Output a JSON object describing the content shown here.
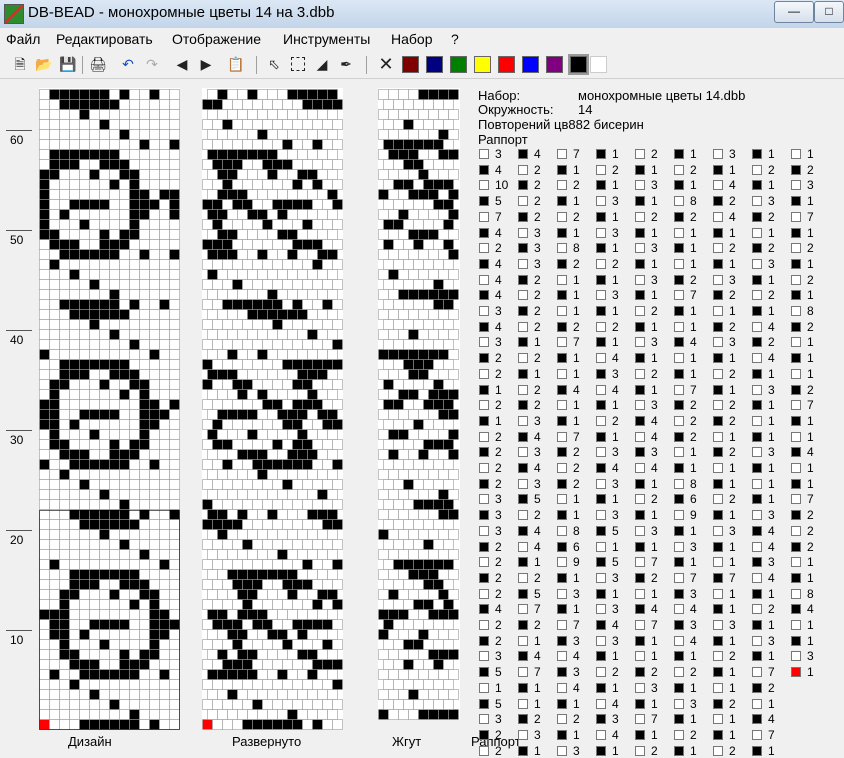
{
  "window": {
    "title": "DB-BEAD - монохромные цветы 14 на 3.dbb"
  },
  "menu": [
    "Файл",
    "Редактировать",
    "Отображение",
    "Инструменты",
    "Набор",
    "?"
  ],
  "palette": [
    "#800000",
    "#000080",
    "#008000",
    "#ffff00",
    "#ff0000",
    "#0000ff",
    "#800080",
    "#000000",
    "#ffffff"
  ],
  "ruler": [
    "60",
    "50",
    "40",
    "30",
    "20",
    "10"
  ],
  "panels": {
    "design": "Дизайн",
    "expanded": "Развернуто",
    "rope": "Жгут",
    "rapport": "Раппорт"
  },
  "info": {
    "set_label": "Набор:",
    "set_value": "монохромные цветы 14.dbb",
    "circ_label": "Окружность:",
    "circ_value": "14",
    "repeat_text": "Повторений цв882 бисерин",
    "rapport_label": "Раппорт"
  },
  "rapport": [
    [
      [
        "w",
        "3"
      ],
      [
        "b",
        "4"
      ],
      [
        "w",
        "7"
      ],
      [
        "b",
        "1"
      ],
      [
        "w",
        "2"
      ],
      [
        "b",
        "1"
      ],
      [
        "w",
        "3"
      ],
      [
        "b",
        "1"
      ],
      [
        "w",
        "1"
      ]
    ],
    [
      [
        "b",
        "4"
      ],
      [
        "w",
        "2"
      ],
      [
        "b",
        "1"
      ],
      [
        "w",
        "2"
      ],
      [
        "b",
        "1"
      ],
      [
        "w",
        "2"
      ],
      [
        "b",
        "1"
      ],
      [
        "w",
        "2"
      ],
      [
        "b",
        "2"
      ]
    ],
    [
      [
        "w",
        "10"
      ],
      [
        "b",
        "2"
      ],
      [
        "w",
        "2"
      ],
      [
        "b",
        "1"
      ],
      [
        "w",
        "3"
      ],
      [
        "b",
        "1"
      ],
      [
        "w",
        "4"
      ],
      [
        "b",
        "1"
      ],
      [
        "w",
        "3"
      ]
    ],
    [
      [
        "b",
        "5"
      ],
      [
        "w",
        "2"
      ],
      [
        "b",
        "1"
      ],
      [
        "w",
        "3"
      ],
      [
        "b",
        "1"
      ],
      [
        "w",
        "8"
      ],
      [
        "b",
        "2"
      ],
      [
        "w",
        "3"
      ],
      [
        "b",
        "1"
      ]
    ],
    [
      [
        "w",
        "7"
      ],
      [
        "b",
        "2"
      ],
      [
        "w",
        "2"
      ],
      [
        "b",
        "1"
      ],
      [
        "w",
        "2"
      ],
      [
        "b",
        "2"
      ],
      [
        "w",
        "4"
      ],
      [
        "b",
        "2"
      ],
      [
        "w",
        "7"
      ]
    ],
    [
      [
        "b",
        "4"
      ],
      [
        "w",
        "3"
      ],
      [
        "b",
        "1"
      ],
      [
        "w",
        "3"
      ],
      [
        "b",
        "1"
      ],
      [
        "w",
        "1"
      ],
      [
        "b",
        "1"
      ],
      [
        "w",
        "1"
      ],
      [
        "b",
        "1"
      ]
    ],
    [
      [
        "w",
        "2"
      ],
      [
        "b",
        "3"
      ],
      [
        "w",
        "8"
      ],
      [
        "b",
        "1"
      ],
      [
        "w",
        "3"
      ],
      [
        "b",
        "1"
      ],
      [
        "w",
        "2"
      ],
      [
        "b",
        "2"
      ],
      [
        "w",
        "2"
      ]
    ],
    [
      [
        "b",
        "4"
      ],
      [
        "w",
        "3"
      ],
      [
        "b",
        "2"
      ],
      [
        "w",
        "2"
      ],
      [
        "b",
        "1"
      ],
      [
        "w",
        "1"
      ],
      [
        "b",
        "1"
      ],
      [
        "w",
        "3"
      ],
      [
        "b",
        "1"
      ]
    ],
    [
      [
        "w",
        "4"
      ],
      [
        "b",
        "2"
      ],
      [
        "w",
        "1"
      ],
      [
        "b",
        "1"
      ],
      [
        "w",
        "3"
      ],
      [
        "b",
        "2"
      ],
      [
        "w",
        "3"
      ],
      [
        "b",
        "1"
      ],
      [
        "w",
        "2"
      ]
    ],
    [
      [
        "b",
        "4"
      ],
      [
        "w",
        "2"
      ],
      [
        "b",
        "1"
      ],
      [
        "w",
        "3"
      ],
      [
        "b",
        "1"
      ],
      [
        "w",
        "7"
      ],
      [
        "b",
        "2"
      ],
      [
        "w",
        "2"
      ],
      [
        "b",
        "1"
      ]
    ],
    [
      [
        "w",
        "3"
      ],
      [
        "b",
        "2"
      ],
      [
        "w",
        "1"
      ],
      [
        "b",
        "1"
      ],
      [
        "w",
        "2"
      ],
      [
        "b",
        "1"
      ],
      [
        "w",
        "1"
      ],
      [
        "b",
        "1"
      ],
      [
        "w",
        "8"
      ]
    ],
    [
      [
        "b",
        "4"
      ],
      [
        "w",
        "2"
      ],
      [
        "b",
        "2"
      ],
      [
        "w",
        "2"
      ],
      [
        "b",
        "1"
      ],
      [
        "w",
        "1"
      ],
      [
        "b",
        "2"
      ],
      [
        "w",
        "4"
      ],
      [
        "b",
        "2"
      ]
    ],
    [
      [
        "w",
        "3"
      ],
      [
        "b",
        "1"
      ],
      [
        "w",
        "7"
      ],
      [
        "b",
        "1"
      ],
      [
        "w",
        "3"
      ],
      [
        "b",
        "4"
      ],
      [
        "w",
        "3"
      ],
      [
        "b",
        "2"
      ],
      [
        "w",
        "1"
      ]
    ],
    [
      [
        "b",
        "2"
      ],
      [
        "w",
        "2"
      ],
      [
        "b",
        "1"
      ],
      [
        "w",
        "4"
      ],
      [
        "b",
        "1"
      ],
      [
        "w",
        "1"
      ],
      [
        "b",
        "1"
      ],
      [
        "w",
        "4"
      ],
      [
        "b",
        "1"
      ]
    ],
    [
      [
        "w",
        "2"
      ],
      [
        "b",
        "1"
      ],
      [
        "w",
        "1"
      ],
      [
        "b",
        "3"
      ],
      [
        "w",
        "2"
      ],
      [
        "b",
        "1"
      ],
      [
        "w",
        "2"
      ],
      [
        "b",
        "1"
      ],
      [
        "w",
        "1"
      ]
    ],
    [
      [
        "b",
        "1"
      ],
      [
        "w",
        "2"
      ],
      [
        "b",
        "4"
      ],
      [
        "w",
        "4"
      ],
      [
        "b",
        "1"
      ],
      [
        "w",
        "7"
      ],
      [
        "b",
        "1"
      ],
      [
        "w",
        "3"
      ],
      [
        "b",
        "2"
      ]
    ],
    [
      [
        "w",
        "2"
      ],
      [
        "b",
        "2"
      ],
      [
        "w",
        "1"
      ],
      [
        "b",
        "1"
      ],
      [
        "w",
        "3"
      ],
      [
        "b",
        "2"
      ],
      [
        "w",
        "2"
      ],
      [
        "b",
        "1"
      ],
      [
        "w",
        "7"
      ]
    ],
    [
      [
        "b",
        "1"
      ],
      [
        "w",
        "3"
      ],
      [
        "b",
        "1"
      ],
      [
        "w",
        "2"
      ],
      [
        "b",
        "4"
      ],
      [
        "w",
        "2"
      ],
      [
        "b",
        "2"
      ],
      [
        "w",
        "1"
      ],
      [
        "b",
        "1"
      ]
    ],
    [
      [
        "w",
        "2"
      ],
      [
        "b",
        "4"
      ],
      [
        "w",
        "7"
      ],
      [
        "b",
        "1"
      ],
      [
        "w",
        "4"
      ],
      [
        "b",
        "2"
      ],
      [
        "w",
        "1"
      ],
      [
        "b",
        "1"
      ],
      [
        "w",
        "1"
      ]
    ],
    [
      [
        "b",
        "2"
      ],
      [
        "w",
        "3"
      ],
      [
        "b",
        "2"
      ],
      [
        "w",
        "3"
      ],
      [
        "b",
        "3"
      ],
      [
        "w",
        "1"
      ],
      [
        "b",
        "2"
      ],
      [
        "w",
        "3"
      ],
      [
        "b",
        "4"
      ]
    ],
    [
      [
        "w",
        "2"
      ],
      [
        "b",
        "4"
      ],
      [
        "w",
        "2"
      ],
      [
        "b",
        "4"
      ],
      [
        "w",
        "4"
      ],
      [
        "b",
        "1"
      ],
      [
        "w",
        "1"
      ],
      [
        "b",
        "1"
      ],
      [
        "w",
        "1"
      ]
    ],
    [
      [
        "b",
        "2"
      ],
      [
        "w",
        "3"
      ],
      [
        "b",
        "2"
      ],
      [
        "w",
        "3"
      ],
      [
        "b",
        "1"
      ],
      [
        "w",
        "8"
      ],
      [
        "b",
        "1"
      ],
      [
        "w",
        "1"
      ],
      [
        "b",
        "1"
      ]
    ],
    [
      [
        "w",
        "3"
      ],
      [
        "b",
        "5"
      ],
      [
        "w",
        "1"
      ],
      [
        "b",
        "1"
      ],
      [
        "w",
        "2"
      ],
      [
        "b",
        "6"
      ],
      [
        "w",
        "2"
      ],
      [
        "b",
        "1"
      ],
      [
        "w",
        "7"
      ]
    ],
    [
      [
        "b",
        "3"
      ],
      [
        "w",
        "2"
      ],
      [
        "b",
        "1"
      ],
      [
        "w",
        "3"
      ],
      [
        "b",
        "1"
      ],
      [
        "w",
        "9"
      ],
      [
        "b",
        "1"
      ],
      [
        "w",
        "3"
      ],
      [
        "b",
        "2"
      ]
    ],
    [
      [
        "w",
        "3"
      ],
      [
        "b",
        "4"
      ],
      [
        "w",
        "8"
      ],
      [
        "b",
        "5"
      ],
      [
        "w",
        "3"
      ],
      [
        "b",
        "1"
      ],
      [
        "w",
        "3"
      ],
      [
        "b",
        "4"
      ],
      [
        "w",
        "2"
      ]
    ],
    [
      [
        "b",
        "2"
      ],
      [
        "w",
        "4"
      ],
      [
        "b",
        "6"
      ],
      [
        "w",
        "1"
      ],
      [
        "b",
        "1"
      ],
      [
        "w",
        "3"
      ],
      [
        "b",
        "1"
      ],
      [
        "w",
        "4"
      ],
      [
        "b",
        "2"
      ]
    ],
    [
      [
        "w",
        "2"
      ],
      [
        "b",
        "1"
      ],
      [
        "w",
        "9"
      ],
      [
        "b",
        "5"
      ],
      [
        "w",
        "7"
      ],
      [
        "b",
        "1"
      ],
      [
        "w",
        "1"
      ],
      [
        "b",
        "3"
      ],
      [
        "w",
        "1"
      ]
    ],
    [
      [
        "b",
        "2"
      ],
      [
        "w",
        "2"
      ],
      [
        "b",
        "1"
      ],
      [
        "w",
        "3"
      ],
      [
        "b",
        "2"
      ],
      [
        "w",
        "7"
      ],
      [
        "b",
        "7"
      ],
      [
        "w",
        "4"
      ],
      [
        "b",
        "1"
      ]
    ],
    [
      [
        "w",
        "2"
      ],
      [
        "b",
        "5"
      ],
      [
        "w",
        "3"
      ],
      [
        "b",
        "1"
      ],
      [
        "w",
        "1"
      ],
      [
        "b",
        "3"
      ],
      [
        "w",
        "1"
      ],
      [
        "b",
        "1"
      ],
      [
        "w",
        "8"
      ]
    ],
    [
      [
        "b",
        "4"
      ],
      [
        "w",
        "7"
      ],
      [
        "b",
        "1"
      ],
      [
        "w",
        "3"
      ],
      [
        "b",
        "4"
      ],
      [
        "w",
        "4"
      ],
      [
        "b",
        "1"
      ],
      [
        "w",
        "2"
      ],
      [
        "b",
        "4"
      ]
    ],
    [
      [
        "w",
        "2"
      ],
      [
        "b",
        "2"
      ],
      [
        "w",
        "7"
      ],
      [
        "b",
        "4"
      ],
      [
        "w",
        "7"
      ],
      [
        "b",
        "3"
      ],
      [
        "w",
        "3"
      ],
      [
        "b",
        "1"
      ],
      [
        "w",
        "1"
      ]
    ],
    [
      [
        "b",
        "2"
      ],
      [
        "w",
        "1"
      ],
      [
        "b",
        "3"
      ],
      [
        "w",
        "3"
      ],
      [
        "b",
        "1"
      ],
      [
        "w",
        "4"
      ],
      [
        "b",
        "1"
      ],
      [
        "w",
        "3"
      ],
      [
        "b",
        "1"
      ]
    ],
    [
      [
        "w",
        "3"
      ],
      [
        "b",
        "4"
      ],
      [
        "w",
        "4"
      ],
      [
        "b",
        "1"
      ],
      [
        "w",
        "1"
      ],
      [
        "b",
        "1"
      ],
      [
        "w",
        "2"
      ],
      [
        "b",
        "1"
      ],
      [
        "w",
        "3"
      ]
    ],
    [
      [
        "b",
        "5"
      ],
      [
        "w",
        "7"
      ],
      [
        "b",
        "3"
      ],
      [
        "w",
        "2"
      ],
      [
        "b",
        "2"
      ],
      [
        "w",
        "2"
      ],
      [
        "b",
        "1"
      ],
      [
        "w",
        "7"
      ],
      [
        "r",
        "1"
      ]
    ],
    [
      [
        "w",
        "1"
      ],
      [
        "b",
        "1"
      ],
      [
        "w",
        "4"
      ],
      [
        "b",
        "1"
      ],
      [
        "w",
        "3"
      ],
      [
        "b",
        "1"
      ],
      [
        "w",
        "1"
      ],
      [
        "b",
        "2"
      ]
    ],
    [
      [
        "b",
        "5"
      ],
      [
        "w",
        "1"
      ],
      [
        "b",
        "1"
      ],
      [
        "w",
        "4"
      ],
      [
        "b",
        "1"
      ],
      [
        "w",
        "3"
      ],
      [
        "b",
        "2"
      ],
      [
        "w",
        "1"
      ]
    ],
    [
      [
        "w",
        "3"
      ],
      [
        "b",
        "2"
      ],
      [
        "w",
        "2"
      ],
      [
        "b",
        "3"
      ],
      [
        "w",
        "7"
      ],
      [
        "b",
        "1"
      ],
      [
        "w",
        "1"
      ],
      [
        "b",
        "4"
      ]
    ],
    [
      [
        "b",
        "2"
      ],
      [
        "w",
        "3"
      ],
      [
        "b",
        "1"
      ],
      [
        "w",
        "4"
      ],
      [
        "b",
        "1"
      ],
      [
        "w",
        "2"
      ],
      [
        "b",
        "1"
      ],
      [
        "w",
        "7"
      ]
    ],
    [
      [
        "w",
        "2"
      ],
      [
        "b",
        "1"
      ],
      [
        "w",
        "3"
      ],
      [
        "b",
        "1"
      ],
      [
        "w",
        "2"
      ],
      [
        "b",
        "1"
      ],
      [
        "w",
        "2"
      ],
      [
        "b",
        "1"
      ]
    ]
  ]
}
